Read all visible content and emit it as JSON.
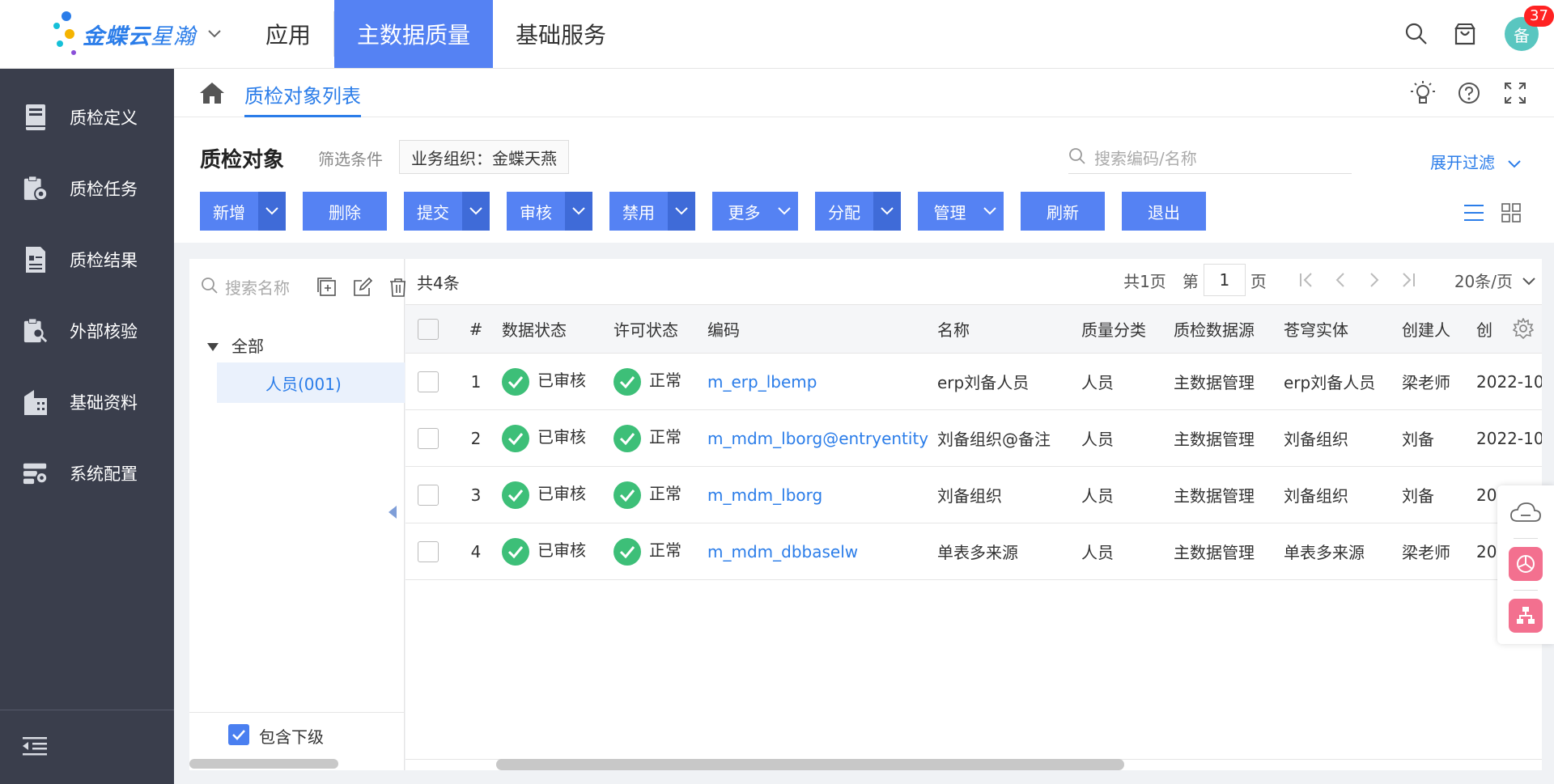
{
  "app": {
    "brand_main": "金蝶云",
    "brand_sub": "星瀚",
    "brand_chevron": "chevron-down-icon",
    "nav": [
      {
        "label": "应用",
        "active": false
      },
      {
        "label": "主数据质量",
        "active": true
      },
      {
        "label": "基础服务",
        "active": false
      }
    ],
    "user_avatar_text": "备",
    "notification_count": "37"
  },
  "sidebar": {
    "items": [
      {
        "label": "质检定义",
        "icon": "book-icon"
      },
      {
        "label": "质检任务",
        "icon": "task-settings-icon"
      },
      {
        "label": "质检结果",
        "icon": "report-icon"
      },
      {
        "label": "外部核验",
        "icon": "clipboard-search-icon"
      },
      {
        "label": "基础资料",
        "icon": "building-icon"
      },
      {
        "label": "系统配置",
        "icon": "config-icon"
      }
    ],
    "collapse_icon": "collapse-menu-icon"
  },
  "breadcrumb": {
    "tab": "质检对象列表"
  },
  "header": {
    "title": "质检对象",
    "filter_label": "筛选条件",
    "filter_tag": "业务组织：金蝶天燕",
    "search_placeholder": "搜索编码/名称",
    "expand_filter": "展开过滤"
  },
  "toolbar": {
    "add": "新增",
    "delete": "删除",
    "submit": "提交",
    "audit": "审核",
    "disable": "禁用",
    "more": "更多",
    "assign": "分配",
    "manage": "管理",
    "refresh": "刷新",
    "exit": "退出"
  },
  "tree": {
    "search_placeholder": "搜索名称",
    "root": "全部",
    "child": "人员(001)",
    "include_sub": "包含下级"
  },
  "grid": {
    "total": "共4条",
    "pages": "共1页",
    "page_prefix": "第",
    "page_value": "1",
    "page_suffix": "页",
    "page_size": "20条/页",
    "columns": [
      "#",
      "数据状态",
      "许可状态",
      "编码",
      "名称",
      "质量分类",
      "质检数据源",
      "苍穹实体",
      "创建人",
      "创"
    ],
    "rows": [
      {
        "num": "1",
        "data_status": "已审核",
        "permit_status": "正常",
        "code": "m_erp_lbemp",
        "name": "erp刘备人员",
        "category": "人员",
        "source": "主数据管理",
        "entity": "erp刘备人员",
        "creator": "梁老师",
        "created": "2022-10"
      },
      {
        "num": "2",
        "data_status": "已审核",
        "permit_status": "正常",
        "code": "m_mdm_lborg@entryentity",
        "name": "刘备组织@备注",
        "category": "人员",
        "source": "主数据管理",
        "entity": "刘备组织",
        "creator": "刘备",
        "created": "2022-10"
      },
      {
        "num": "3",
        "data_status": "已审核",
        "permit_status": "正常",
        "code": "m_mdm_lborg",
        "name": "刘备组织",
        "category": "人员",
        "source": "主数据管理",
        "entity": "刘备组织",
        "creator": "刘备",
        "created": "20"
      },
      {
        "num": "4",
        "data_status": "已审核",
        "permit_status": "正常",
        "code": "m_mdm_dbbaselw",
        "name": "单表多来源",
        "category": "人员",
        "source": "主数据管理",
        "entity": "单表多来源",
        "creator": "梁老师",
        "created": "20"
      }
    ]
  },
  "colors": {
    "accent": "#5582f3",
    "accent_dark": "#3f6bd8",
    "link": "#2b7de9",
    "sidebar": "#3a3e4c",
    "success": "#3dbf78",
    "badge": "#ff2222"
  }
}
